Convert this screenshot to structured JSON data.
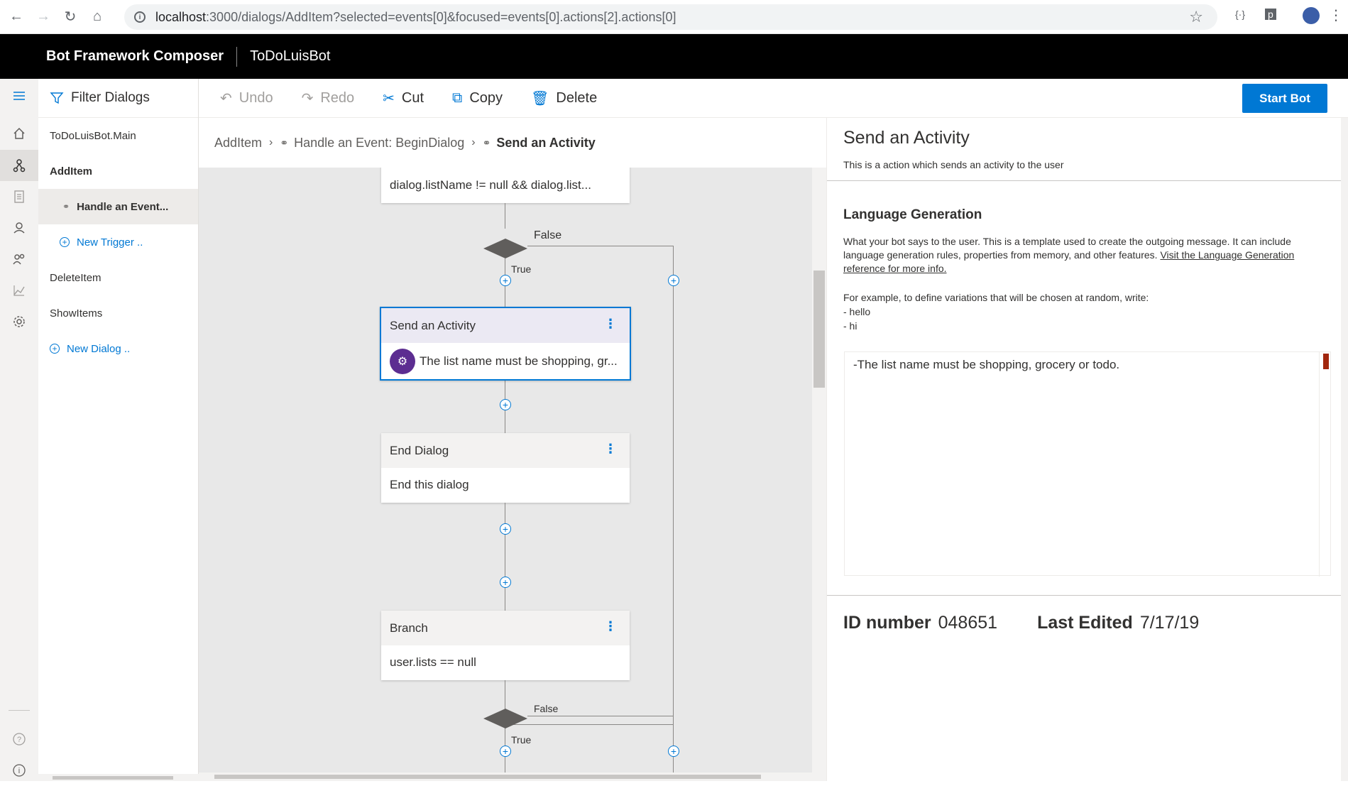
{
  "browser": {
    "url_host": "localhost",
    "url_path": ":3000/dialogs/AddItem?selected=events[0]&focused=events[0].actions[2].actions[0]"
  },
  "app": {
    "title": "Bot Framework Composer",
    "bot_name": "ToDoLuisBot"
  },
  "dialogs": {
    "filter_label": "Filter Dialogs",
    "items": [
      {
        "label": "ToDoLuisBot.Main"
      },
      {
        "label": "AddItem"
      },
      {
        "label": "Handle an Event..."
      },
      {
        "label": "New Trigger .."
      },
      {
        "label": "DeleteItem"
      },
      {
        "label": "ShowItems"
      },
      {
        "label": "New Dialog .."
      }
    ]
  },
  "toolbar": {
    "undo": "Undo",
    "redo": "Redo",
    "cut": "Cut",
    "copy": "Copy",
    "delete": "Delete",
    "start_bot": "Start Bot"
  },
  "breadcrumb": {
    "root": "AddItem",
    "event": "Handle an Event: BeginDialog",
    "current": "Send an Activity"
  },
  "canvas": {
    "condition_text": "dialog.listName != null && dialog.list...",
    "false_label": "False",
    "true_label": "True",
    "send_activity": {
      "title": "Send an Activity",
      "body": "The list name must be shopping, gr..."
    },
    "end_dialog": {
      "title": "End Dialog",
      "body": "End this dialog"
    },
    "branch": {
      "title": "Branch",
      "body": "user.lists == null"
    },
    "false_label_2": "False",
    "true_label_2": "True"
  },
  "panel": {
    "title": "Send an Activity",
    "description": "This is a action which sends an activity to the user",
    "lg_heading": "Language Generation",
    "help_text": "What your bot says to the user. This is a template used to create the outgoing message. It can include language generation rules, properties from memory, and other features.",
    "help_link": "Visit the Language Generation reference for more info.",
    "example_intro": "For example, to define variations that will be chosen at random, write:",
    "example_line1": "- hello",
    "example_line2": "- hi",
    "editor_text": "-The list name must be shopping, grocery or todo.",
    "id_label": "ID number",
    "id_value": "048651",
    "edited_label": "Last Edited",
    "edited_value": "7/17/19"
  },
  "colors": {
    "accent": "#0078d4",
    "header_bg": "#000000",
    "bot_avatar": "#5c2d91"
  }
}
